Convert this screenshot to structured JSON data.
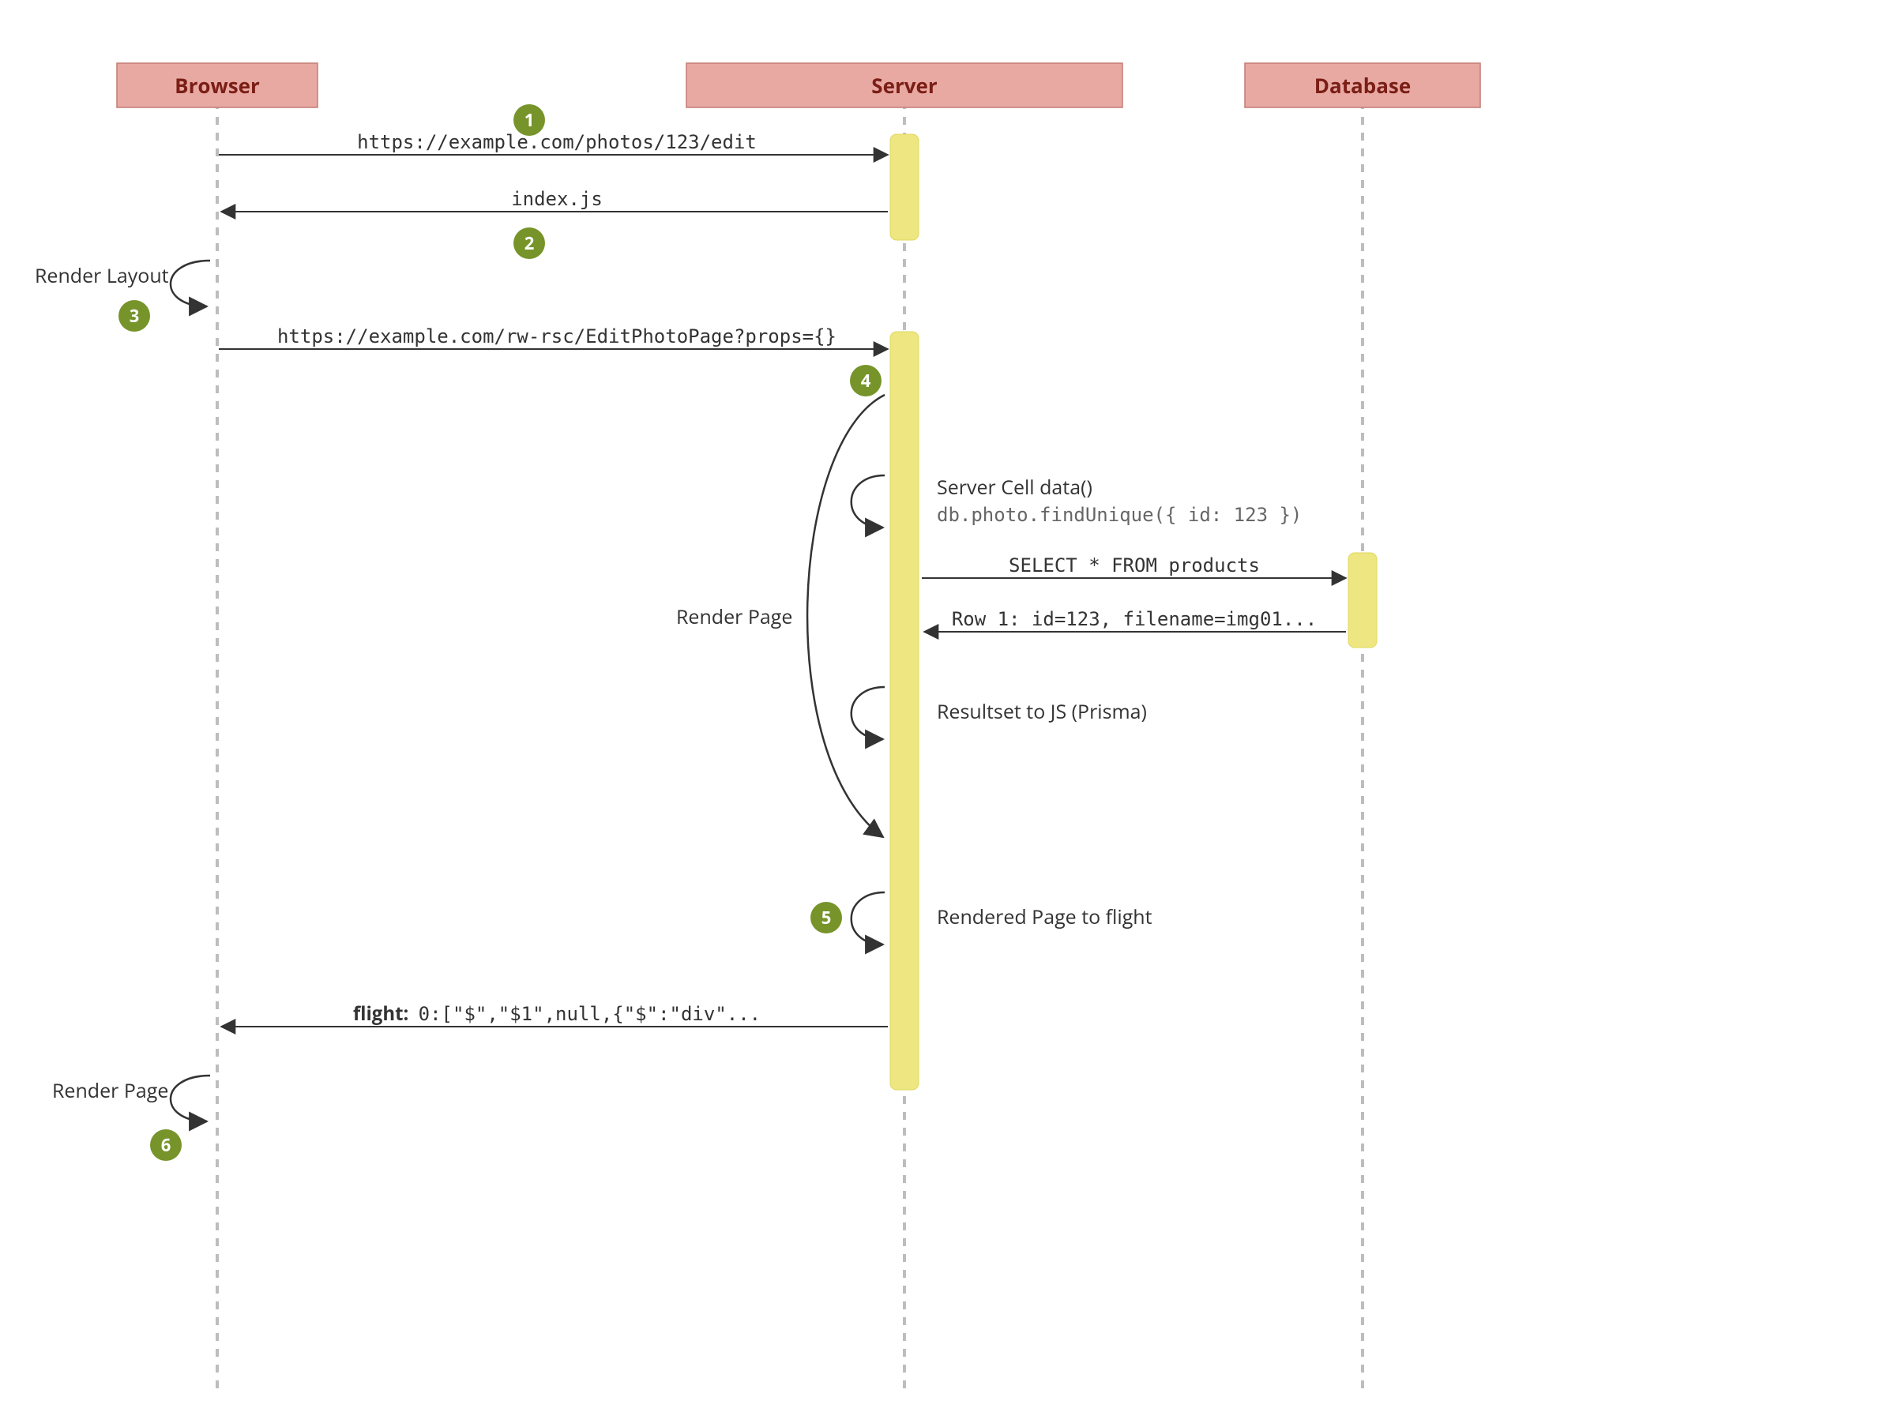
{
  "participants": {
    "browser": "Browser",
    "server": "Server",
    "database": "Database"
  },
  "steps": {
    "s1": "1",
    "s2": "2",
    "s3": "3",
    "s4": "4",
    "s5": "5",
    "s6": "6"
  },
  "messages": {
    "req_url": "https://example.com/photos/123/edit",
    "index_js": "index.js",
    "render_layout": "Render Layout",
    "rsc_url": "https://example.com/rw-rsc/EditPhotoPage?props={}",
    "render_page_big": "Render Page",
    "cell_data_label": "Server Cell data()",
    "cell_data_code": "db.photo.findUnique({ id: 123 })",
    "sql_select": "SELECT * FROM products",
    "sql_row": "Row 1: id=123, filename=img01...",
    "resultset": "Resultset to JS (Prisma)",
    "rendered_to_flight": "Rendered Page to flight",
    "flight_label": "flight:",
    "flight_payload": "0:[\"$\",\"$1\",null,{\"$\":\"div\"...",
    "render_page_bottom": "Render Page"
  }
}
